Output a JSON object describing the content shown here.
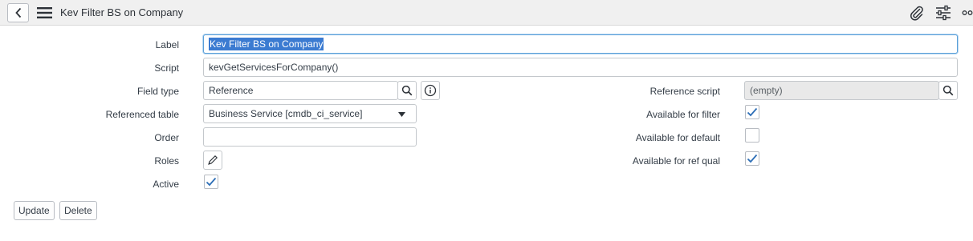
{
  "header": {
    "title": "Kev Filter BS on Company",
    "icons": [
      "back-arrow-icon",
      "hamburger-menu-icon",
      "paperclip-icon",
      "settings-sliders-icon",
      "more-options-icon"
    ]
  },
  "form": {
    "label": {
      "label": "Label",
      "value": "Kev Filter BS on Company"
    },
    "script": {
      "label": "Script",
      "value": "kevGetServicesForCompany()"
    },
    "field_type": {
      "label": "Field type",
      "value": "Reference"
    },
    "referenced_table": {
      "label": "Referenced table",
      "value": "Business Service [cmdb_ci_service]"
    },
    "order": {
      "label": "Order",
      "value": ""
    },
    "roles": {
      "label": "Roles"
    },
    "active": {
      "label": "Active",
      "checked": true
    },
    "reference_script": {
      "label": "Reference script",
      "value": "(empty)"
    },
    "available_for_filter": {
      "label": "Available for filter",
      "checked": true
    },
    "available_for_default": {
      "label": "Available for default",
      "checked": false
    },
    "available_for_ref_qual": {
      "label": "Available for ref qual",
      "checked": true
    }
  },
  "buttons": {
    "update": "Update",
    "delete": "Delete"
  },
  "colors": {
    "accent": "#3b7bd1",
    "checkmark": "#2e6fb7",
    "header_bg": "#f0f0f0"
  }
}
